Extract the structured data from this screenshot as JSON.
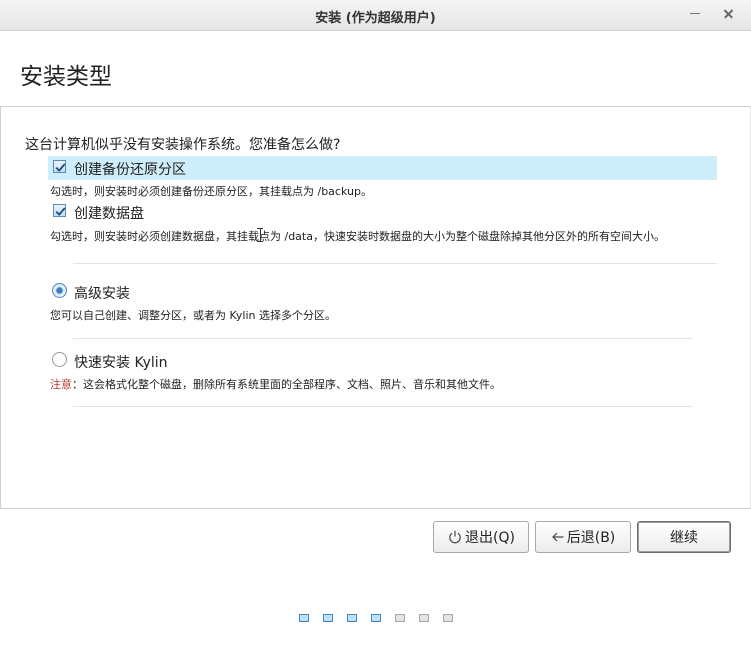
{
  "window": {
    "title": "安装 (作为超级用户)"
  },
  "page": {
    "title": "安装类型",
    "question": "这台计算机似乎没有安装操作系统。您准备怎么做?"
  },
  "options": {
    "backup": {
      "label": "创建备份还原分区",
      "checked": true,
      "description": "勾选时，则安装时必须创建备份还原分区，其挂载点为 /backup。"
    },
    "data_disk": {
      "label": "创建数据盘",
      "checked": true,
      "description": "勾选时，则安装时必须创建数据盘，其挂载点为 /data，快速安装时数据盘的大小为整个磁盘除掉其他分区外的所有空间大小。"
    },
    "advanced": {
      "label": "高级安装",
      "selected": true,
      "description": "您可以自己创建、调整分区，或者为 Kylin 选择多个分区。"
    },
    "quick": {
      "label": "快速安装 Kylin",
      "selected": false,
      "warning_label": "注意",
      "description": "：这会格式化整个磁盘，删除所有系统里面的全部程序、文档、照片、音乐和其他文件。"
    }
  },
  "buttons": {
    "quit": "退出(Q)",
    "back": "后退(B)",
    "continue": "继续"
  },
  "progress": {
    "total_steps": 7,
    "current_step": 4
  },
  "colors": {
    "highlight_row": "#cdeefa",
    "warning": "#c0392b",
    "active_step": "#3b86c6"
  }
}
